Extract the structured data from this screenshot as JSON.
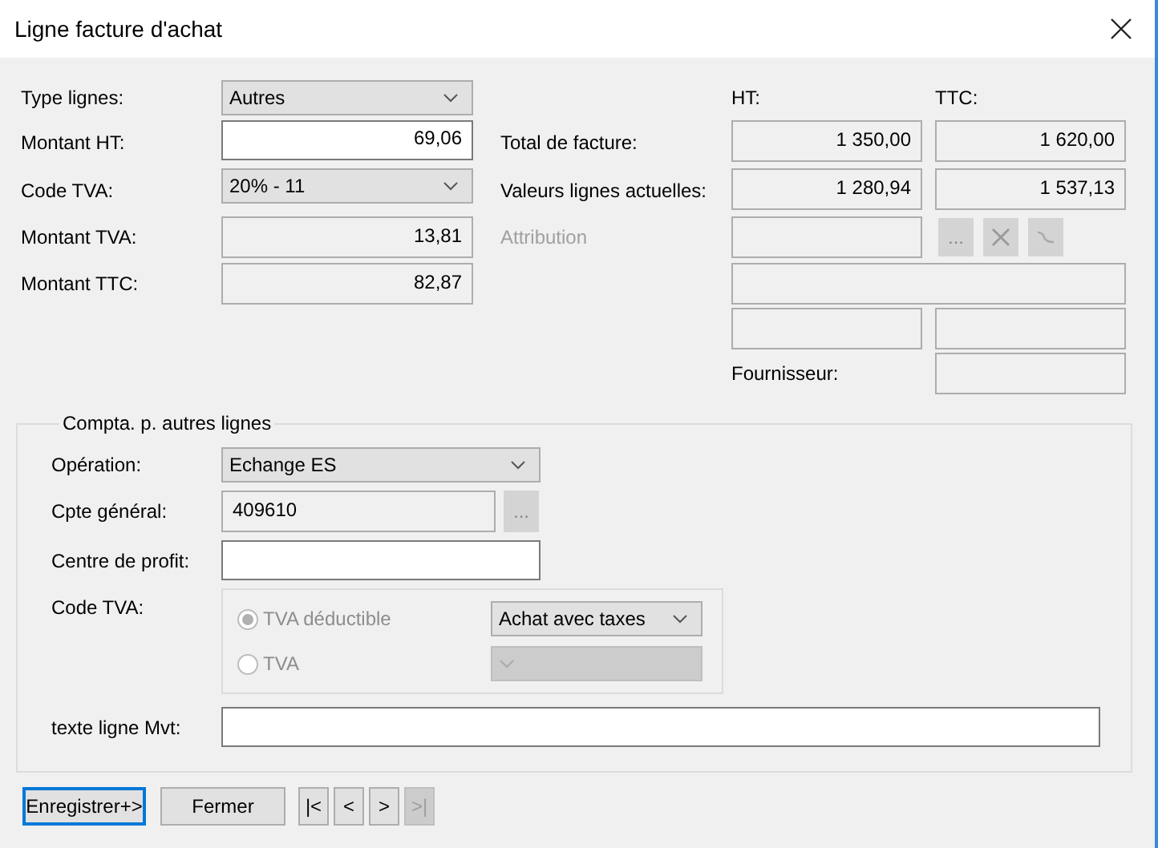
{
  "window": {
    "title": "Ligne facture d'achat"
  },
  "fields": [
    {
      "label": "Type lignes:",
      "kind": "dropdown",
      "value": "Autres"
    },
    {
      "label": "Montant HT:",
      "kind": "input",
      "value": "69,06"
    },
    {
      "label": "Code TVA:",
      "kind": "dropdown",
      "value": "20% - 11"
    },
    {
      "label": "Montant TVA:",
      "kind": "readonly",
      "value": "13,81"
    },
    {
      "label": "Montant TTC:",
      "kind": "readonly",
      "value": "82,87"
    }
  ],
  "totals": {
    "columns": [
      "HT:",
      "TTC:"
    ],
    "rows": [
      {
        "label": "Total de facture:",
        "values": [
          "1 350,00",
          "1 620,00"
        ]
      },
      {
        "label": "Valeurs lignes actuelles:",
        "values": [
          "1 280,94",
          "1 537,13"
        ]
      }
    ]
  },
  "attribution": {
    "label": "Attribution",
    "disabled": true,
    "buttons": [
      {
        "kind": "browse",
        "text": "..."
      },
      {
        "kind": "clear"
      },
      {
        "kind": "link"
      }
    ]
  },
  "supplier": {
    "label": "Fournisseur:"
  },
  "group": {
    "title": "Compta. p. autres lignes",
    "rows": [
      {
        "label": "Opération:",
        "kind": "dropdown",
        "value": "Echange ES"
      },
      {
        "label": "Cpte général:",
        "kind": "browse",
        "value": "409610",
        "button": "..."
      },
      {
        "label": "Centre de profit:",
        "kind": "input"
      },
      {
        "label": "Code TVA:",
        "kind": "tva",
        "disabled": true,
        "options": [
          {
            "label": "TVA déductible",
            "selected": true,
            "value": "Achat avec taxes"
          },
          {
            "label": "TVA",
            "selected": false
          }
        ]
      },
      {
        "label": "texte ligne Mvt:",
        "kind": "text"
      }
    ]
  },
  "buttons": [
    {
      "label": "Enregistrer+>",
      "kind": "default"
    },
    {
      "label": "Fermer",
      "kind": "normal"
    }
  ],
  "nav": [
    {
      "label": "|<",
      "disabled": false
    },
    {
      "label": "<",
      "disabled": false
    },
    {
      "label": ">",
      "disabled": false
    },
    {
      "label": ">|",
      "disabled": true
    }
  ]
}
